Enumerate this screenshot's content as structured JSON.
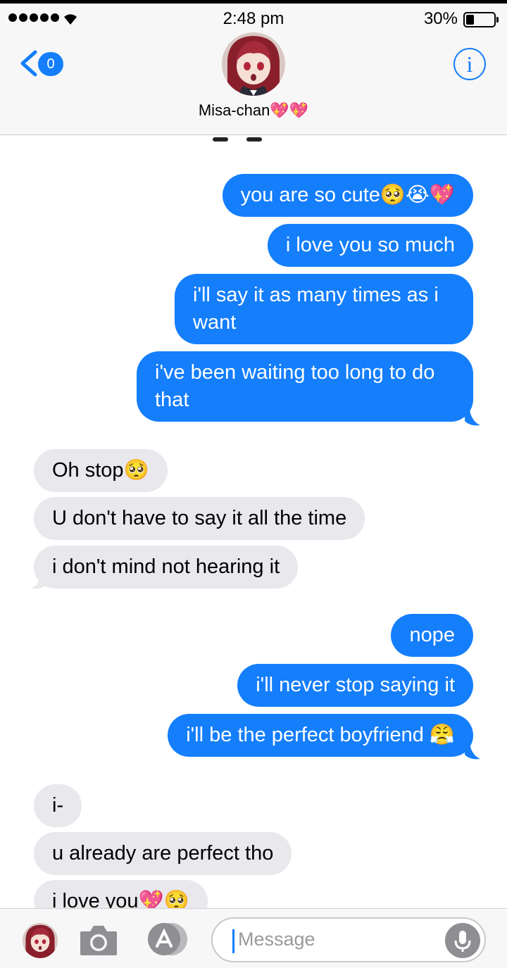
{
  "status_bar": {
    "time": "2:48 pm",
    "battery_percent": "30%",
    "battery_level": 0.3,
    "signal_bars": 5
  },
  "header": {
    "back_badge": "0",
    "contact_name": "Misa-chan💖💖",
    "info_label": "i"
  },
  "messages": [
    {
      "side": "sent",
      "text": "you are so cute🥺😭💖"
    },
    {
      "side": "sent",
      "text": "i love you so much"
    },
    {
      "side": "sent",
      "text": "i'll say it as many times as i want"
    },
    {
      "side": "sent",
      "text": "i've been waiting too long to do that"
    },
    {
      "side": "recv",
      "text": "Oh stop🥺"
    },
    {
      "side": "recv",
      "text": "U don't have to say it all the time"
    },
    {
      "side": "recv",
      "text": "i don't mind not hearing it"
    },
    {
      "side": "sent",
      "text": "nope"
    },
    {
      "side": "sent",
      "text": "i'll never stop saying it"
    },
    {
      "side": "sent",
      "text": "i'll be the perfect boyfriend 😤"
    },
    {
      "side": "recv",
      "text": "i-"
    },
    {
      "side": "recv",
      "text": "u already are perfect tho"
    },
    {
      "side": "recv",
      "text": "i love you💖🥺"
    }
  ],
  "composer": {
    "placeholder": "Message"
  },
  "colors": {
    "sent_bubble": "#147efb",
    "received_bubble": "#e8e8ed",
    "accent": "#147efb"
  }
}
